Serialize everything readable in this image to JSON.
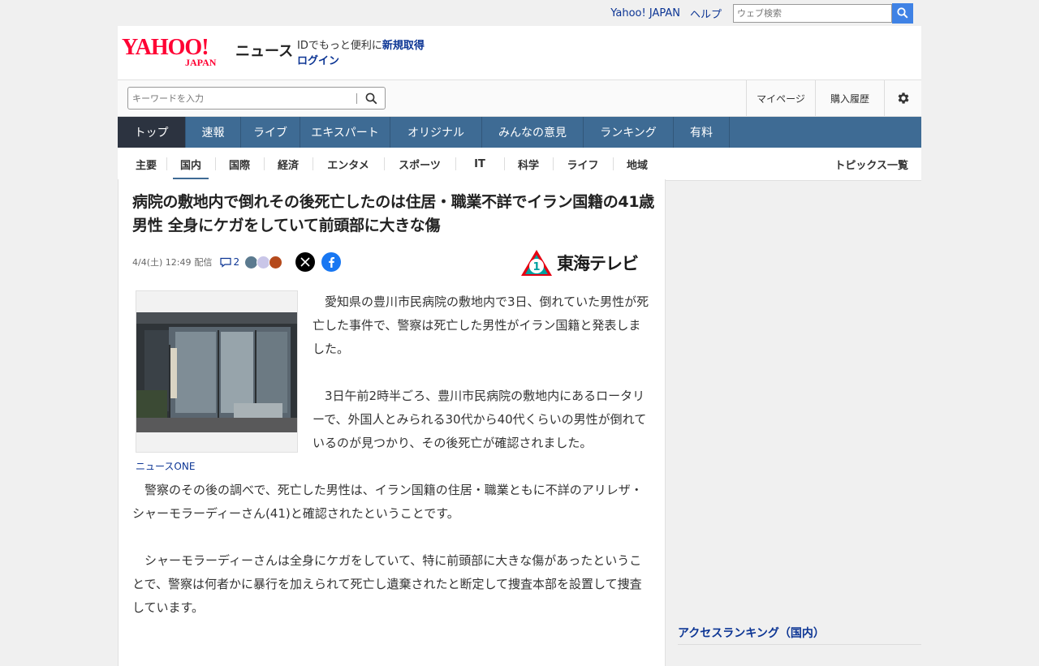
{
  "topbar": {
    "links": [
      "Yahoo! JAPAN",
      "ヘルプ"
    ],
    "search_placeholder": "ウェブ検索"
  },
  "header": {
    "logo_text": "YAHOO!",
    "logo_sub": "JAPAN",
    "service_name": "ニュース",
    "id_message": "IDでもっと便利に",
    "signup_label": "新規取得",
    "login_label": "ログイン"
  },
  "searchbar": {
    "keyword_placeholder": "キーワードを入力",
    "mypage_label": "マイページ",
    "history_label": "購入履歴"
  },
  "main_nav": {
    "items": [
      "トップ",
      "速報",
      "ライブ",
      "エキスパート",
      "オリジナル",
      "みんなの意見",
      "ランキング",
      "有料"
    ],
    "active": "トップ"
  },
  "sub_nav": {
    "items": [
      "主要",
      "国内",
      "国際",
      "経済",
      "エンタメ",
      "スポーツ",
      "IT",
      "科学",
      "ライフ",
      "地域"
    ],
    "active": "国内",
    "topics_label": "トピックス一覧"
  },
  "article": {
    "title": "病院の敷地内で倒れその後死亡したのは住居・職業不詳でイラン国籍の41歳男性 全身にケガをしていて前頭部に大きな傷",
    "date": "4/4(土) 12:49",
    "posted_label": "配信",
    "comment_count": "2",
    "publisher": "東海テレビ",
    "publisher_badge": "1",
    "photo_caption": "ニュースONE",
    "paragraphs": [
      "愛知県の豊川市民病院の敷地内で3日、倒れていた男性が死亡した事件で、警察は死亡した男性がイラン国籍と発表しました。",
      "3日午前2時半ごろ、豊川市民病院の敷地内にあるロータリーで、外国人とみられる30代から40代くらいの男性が倒れているのが見つかり、その後死亡が確認されました。",
      "警察のその後の調べで、死亡した男性は、イラン国籍の住居・職業ともに不詳のアリレザ・シャーモラーディーさん(41)と確認されたということです。",
      "シャーモラーディーさんは全身にケガをしていて、特に前頭部に大きな傷があったということで、警察は何者かに暴行を加えられて死亡し遺棄されたと断定して捜査本部を設置して捜査しています。"
    ]
  },
  "sidebar": {
    "ranking_title": "アクセスランキング（国内）"
  },
  "colors": {
    "nav_bg": "#3e6b94",
    "nav_active": "#2c3340",
    "link": "#0c3594",
    "logo_red": "#ff0033",
    "search_btn": "#3f82e5",
    "facebook": "#1877f2",
    "tokai_green": "#00a0a0",
    "tokai_red": "#e60012"
  }
}
